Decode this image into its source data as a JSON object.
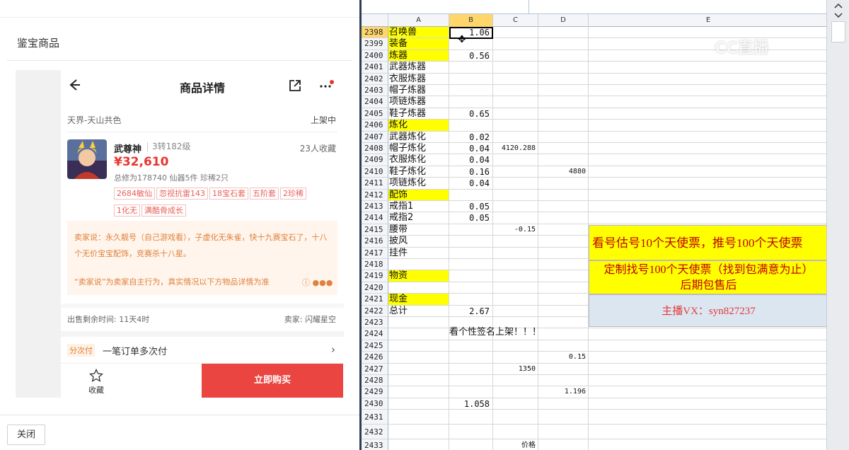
{
  "dialog": {
    "title": "鉴宝商品",
    "close_label": "关闭"
  },
  "product": {
    "nav_title": "商品详情",
    "server": "天界-天山共色",
    "status": "上架中",
    "role_name": "武尊神",
    "role_level": "3转182级",
    "favorites": "23人收藏",
    "price": "¥32,610",
    "stats": "总修为178740  仙器5件  珍稀2只",
    "tags": [
      "2684敏仙",
      "忽视抗雷143",
      "18宝石套",
      "五阶套",
      "2珍稀",
      "1化无",
      "满酷骨成长"
    ],
    "seller_says": "卖家说：永久靓号（自己游戏看），子虚化无朱雀，快十九赛宝石了，十八个无价宝宝配饰，竞赛杀十八星。",
    "seller_note": "“卖家说”为卖家自主行为，真实情况以下方物品详情为准",
    "remaining": "出售剩余时间: 11天4时",
    "seller": "卖家: 闪耀星空",
    "pay_tag": "分次付",
    "pay_text": "一笔订单多次付",
    "fav_label": "收藏",
    "buy_label": "立即购买"
  },
  "sheet": {
    "columns": [
      "A",
      "B",
      "C",
      "D",
      "E"
    ],
    "rows": [
      {
        "n": "2398",
        "a": "召唤兽",
        "b": "1.06",
        "c": "",
        "d": "",
        "ya": true
      },
      {
        "n": "2399",
        "a": "装备",
        "b": "",
        "c": "",
        "d": "",
        "ya": true
      },
      {
        "n": "2400",
        "a": "炼器",
        "b": "0.56",
        "c": "",
        "d": "",
        "ya": true
      },
      {
        "n": "2401",
        "a": "武器炼器",
        "b": "",
        "c": "",
        "d": ""
      },
      {
        "n": "2402",
        "a": "衣服炼器",
        "b": "",
        "c": "",
        "d": ""
      },
      {
        "n": "2403",
        "a": "帽子炼器",
        "b": "",
        "c": "",
        "d": ""
      },
      {
        "n": "2404",
        "a": "项链炼器",
        "b": "",
        "c": "",
        "d": ""
      },
      {
        "n": "2405",
        "a": "鞋子炼器",
        "b": "0.65",
        "c": "",
        "d": ""
      },
      {
        "n": "2406",
        "a": "炼化",
        "b": "",
        "c": "",
        "d": "",
        "ya": true
      },
      {
        "n": "2407",
        "a": "武器炼化",
        "b": "0.02",
        "c": "",
        "d": ""
      },
      {
        "n": "2408",
        "a": "帽子炼化",
        "b": "0.04",
        "c": "4120.288",
        "d": ""
      },
      {
        "n": "2409",
        "a": "衣服炼化",
        "b": "0.04",
        "c": "",
        "d": ""
      },
      {
        "n": "2410",
        "a": "鞋子炼化",
        "b": "0.16",
        "c": "",
        "d": "4880"
      },
      {
        "n": "2411",
        "a": "项链炼化",
        "b": "0.04",
        "c": "",
        "d": ""
      },
      {
        "n": "2412",
        "a": "配饰",
        "b": "",
        "c": "",
        "d": "",
        "ya": true
      },
      {
        "n": "2413",
        "a": "戒指1",
        "b": "0.05",
        "c": "",
        "d": ""
      },
      {
        "n": "2414",
        "a": "戒指2",
        "b": "0.05",
        "c": "",
        "d": ""
      },
      {
        "n": "2415",
        "a": "腰带",
        "b": "",
        "c": "-0.15",
        "d": ""
      },
      {
        "n": "2416",
        "a": "披风",
        "b": "",
        "c": "",
        "d": ""
      },
      {
        "n": "2417",
        "a": "挂件",
        "b": "",
        "c": "",
        "d": ""
      },
      {
        "n": "2418",
        "a": "",
        "b": "",
        "c": "",
        "d": ""
      },
      {
        "n": "2419",
        "a": "物资",
        "b": "",
        "c": "",
        "d": "",
        "ya": true
      },
      {
        "n": "2420",
        "a": "",
        "b": "",
        "c": "",
        "d": ""
      },
      {
        "n": "2421",
        "a": "现金",
        "b": "",
        "c": "",
        "d": "",
        "ya": true
      },
      {
        "n": "2422",
        "a": "总计",
        "b": "2.67",
        "c": "",
        "d": ""
      },
      {
        "n": "2423",
        "a": "",
        "b": "",
        "c": "",
        "d": ""
      },
      {
        "n": "2424",
        "a": "",
        "b": "",
        "c": "",
        "d": ""
      },
      {
        "n": "2425",
        "a": "",
        "b": "",
        "c": "",
        "d": ""
      },
      {
        "n": "2426",
        "a": "",
        "b": "",
        "c": "",
        "d": "0.15"
      },
      {
        "n": "2427",
        "a": "",
        "b": "",
        "c": "1350",
        "d": ""
      },
      {
        "n": "2428",
        "a": "",
        "b": "",
        "c": "",
        "d": ""
      },
      {
        "n": "2429",
        "a": "",
        "b": "",
        "c": "",
        "d": "1.196"
      },
      {
        "n": "2430",
        "a": "",
        "b": "1.058",
        "c": "",
        "d": ""
      },
      {
        "n": "2431",
        "a": "",
        "b": "",
        "c": "",
        "d": ""
      },
      {
        "n": "2432",
        "a": "",
        "b": "",
        "c": "",
        "d": ""
      },
      {
        "n": "2433",
        "a": "",
        "b": "",
        "c": "价格",
        "d": ""
      }
    ],
    "e_notice_1": "看号估号10个天使票，推号100个天使票",
    "e_notice_2a": "定制找号100个天使票（找到包满意为止）",
    "e_notice_2b": "后期包售后",
    "e_notice_3": "主播VX：syn827237",
    "overflow_2424": "看个性签名上架！！！",
    "watermark": "CC直播"
  },
  "colors": {
    "accent_red": "#ea4540",
    "yellow_fill": "#ffff00",
    "notice_red": "#c00000"
  }
}
